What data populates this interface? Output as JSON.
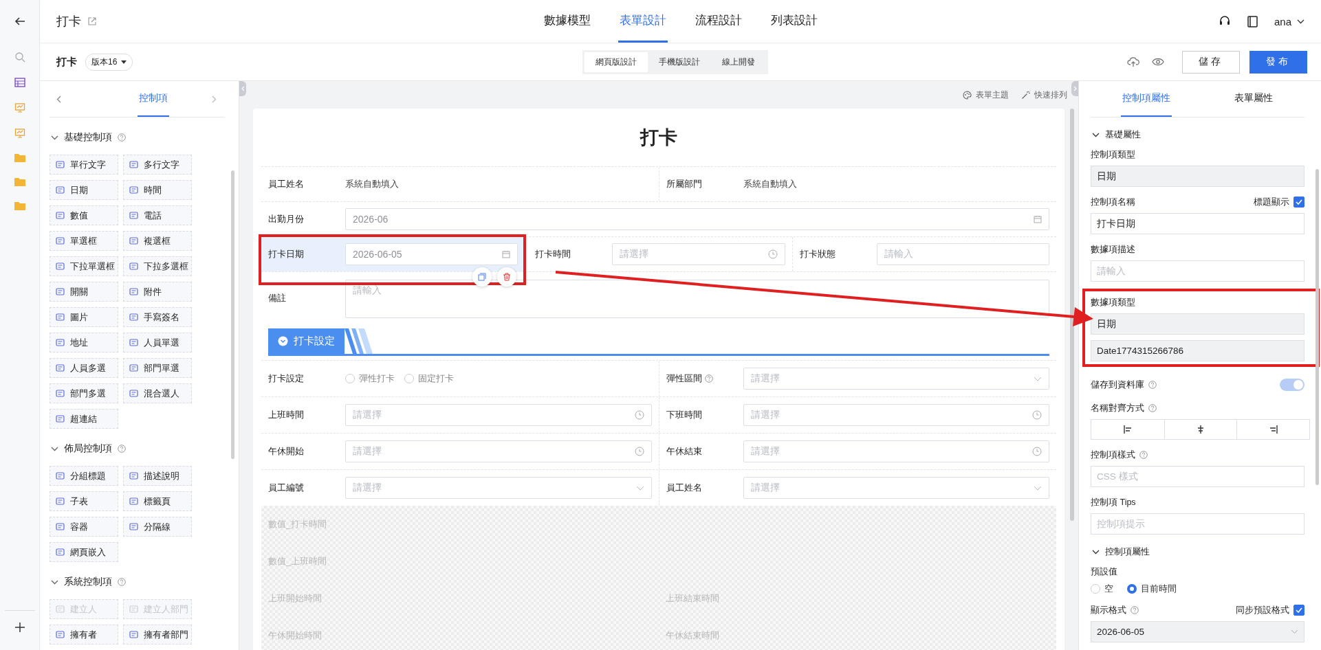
{
  "header": {
    "title": "打卡",
    "tabs": [
      {
        "label": "數據模型",
        "selected": false
      },
      {
        "label": "表單設計",
        "selected": true
      },
      {
        "label": "流程設計",
        "selected": false
      },
      {
        "label": "列表設計",
        "selected": false
      }
    ],
    "user": "ana"
  },
  "toolbar": {
    "title": "打卡",
    "version": "版本16",
    "modes": [
      {
        "label": "網頁版設計",
        "selected": true
      },
      {
        "label": "手機版設計",
        "selected": false
      },
      {
        "label": "線上開發",
        "selected": false
      }
    ],
    "save": "儲存",
    "publish": "發布"
  },
  "controls_panel": {
    "tab": "控制項",
    "sections": [
      {
        "title": "基礎控制項",
        "help": true,
        "expanded": true,
        "items": [
          {
            "label": "單行文字",
            "disabled": false
          },
          {
            "label": "多行文字",
            "disabled": false
          },
          {
            "label": "日期",
            "disabled": false
          },
          {
            "label": "時間",
            "disabled": false
          },
          {
            "label": "數值",
            "disabled": false
          },
          {
            "label": "電話",
            "disabled": false
          },
          {
            "label": "單選框",
            "disabled": false
          },
          {
            "label": "複選框",
            "disabled": false
          },
          {
            "label": "下拉單選框",
            "disabled": false
          },
          {
            "label": "下拉多選框",
            "disabled": false
          },
          {
            "label": "開關",
            "disabled": false
          },
          {
            "label": "附件",
            "disabled": false
          },
          {
            "label": "圖片",
            "disabled": false
          },
          {
            "label": "手寫簽名",
            "disabled": false
          },
          {
            "label": "地址",
            "disabled": false
          },
          {
            "label": "人員單選",
            "disabled": false
          },
          {
            "label": "人員多選",
            "disabled": false
          },
          {
            "label": "部門單選",
            "disabled": false
          },
          {
            "label": "部門多選",
            "disabled": false
          },
          {
            "label": "混合選人",
            "disabled": false
          },
          {
            "label": "超連結",
            "disabled": false
          }
        ]
      },
      {
        "title": "佈局控制項",
        "help": true,
        "expanded": true,
        "items": [
          {
            "label": "分組標題",
            "disabled": false
          },
          {
            "label": "描述說明",
            "disabled": false
          },
          {
            "label": "子表",
            "disabled": false
          },
          {
            "label": "標籤頁",
            "disabled": false
          },
          {
            "label": "容器",
            "disabled": false
          },
          {
            "label": "分隔線",
            "disabled": false
          },
          {
            "label": "網頁嵌入",
            "disabled": false
          }
        ]
      },
      {
        "title": "系統控制項",
        "help": true,
        "expanded": true,
        "items": [
          {
            "label": "建立人",
            "disabled": true
          },
          {
            "label": "建立人部門",
            "disabled": true
          },
          {
            "label": "擁有者",
            "disabled": false
          },
          {
            "label": "擁有者部門",
            "disabled": false
          }
        ]
      }
    ]
  },
  "canvas": {
    "tools": [
      "表單主題",
      "快速排列"
    ],
    "form_title": "打卡",
    "rows": [
      [
        {
          "label": "員工姓名",
          "kind": "text",
          "value": "系統自動填入"
        },
        {
          "label": "所屬部門",
          "kind": "text",
          "value": "系統自動填入"
        }
      ],
      [
        {
          "label": "出勤月份",
          "kind": "date",
          "value": "2026-06"
        }
      ],
      [
        {
          "label": "打卡日期",
          "kind": "date",
          "value": "2026-06-05",
          "selected": true
        },
        {
          "label": "打卡時間",
          "kind": "time",
          "placeholder": "請選擇"
        },
        {
          "label": "打卡狀態",
          "kind": "input",
          "placeholder": "請輸入"
        }
      ],
      [
        {
          "label": "備註",
          "kind": "textarea",
          "placeholder": "請輸入"
        }
      ]
    ],
    "group_title": "打卡設定",
    "group_rows": [
      [
        {
          "label": "打卡設定",
          "kind": "radio",
          "options": [
            {
              "label": "彈性打卡",
              "selected": false
            },
            {
              "label": "固定打卡",
              "selected": false
            }
          ]
        },
        {
          "label": "彈性區間",
          "help": true,
          "kind": "select",
          "placeholder": "請選擇"
        }
      ],
      [
        {
          "label": "上班時間",
          "kind": "time",
          "placeholder": "請選擇"
        },
        {
          "label": "下班時間",
          "kind": "time",
          "placeholder": "請選擇"
        }
      ],
      [
        {
          "label": "午休開始",
          "kind": "time",
          "placeholder": "請選擇"
        },
        {
          "label": "午休結束",
          "kind": "time",
          "placeholder": "請選擇"
        }
      ],
      [
        {
          "label": "員工編號",
          "kind": "select",
          "placeholder": "請選擇"
        },
        {
          "label": "員工姓名",
          "kind": "select",
          "placeholder": "請選擇"
        }
      ]
    ],
    "hidden_rows": [
      [
        "數值_打卡時間"
      ],
      [
        "數值_上班時間"
      ],
      [
        "上班開始時間",
        "上班結束時間"
      ],
      [
        "午休開始時間",
        "午休結束時間"
      ]
    ]
  },
  "properties": {
    "tabs": [
      {
        "label": "控制項屬性",
        "selected": true
      },
      {
        "label": "表單屬性",
        "selected": false
      }
    ],
    "sections": [
      {
        "title": "基礎屬性",
        "expanded": true,
        "fields": [
          {
            "kind": "readonly",
            "label": "控制項類型",
            "values": [
              "日期"
            ]
          },
          {
            "kind": "input",
            "label": "控制項名稱",
            "value": "打卡日期",
            "check": {
              "label": "標題顯示",
              "checked": true
            }
          },
          {
            "kind": "input",
            "label": "數據項描述",
            "placeholder": "請輸入"
          },
          {
            "kind": "readonly",
            "label": "數據項類型",
            "values": [
              "日期",
              "Date1774315266786"
            ],
            "annotated": true
          },
          {
            "kind": "toggle",
            "label": "儲存到資料庫",
            "help": true,
            "on": true
          },
          {
            "kind": "align",
            "label": "名稱對齊方式",
            "help": true
          },
          {
            "kind": "input",
            "label": "控制項樣式",
            "help": true,
            "placeholder": "CSS 樣式"
          },
          {
            "kind": "input",
            "label": "控制項 Tips",
            "placeholder": "控制項提示"
          }
        ]
      },
      {
        "title": "控制項屬性",
        "expanded": true,
        "fields": [
          {
            "kind": "radio",
            "label": "預設值",
            "options": [
              {
                "label": "空",
                "selected": false
              },
              {
                "label": "目前時間",
                "selected": true
              }
            ]
          },
          {
            "kind": "select",
            "label": "顯示格式",
            "help": true,
            "value": "2026-06-05",
            "check": {
              "label": "同步預設格式",
              "checked": true
            }
          }
        ]
      }
    ]
  }
}
